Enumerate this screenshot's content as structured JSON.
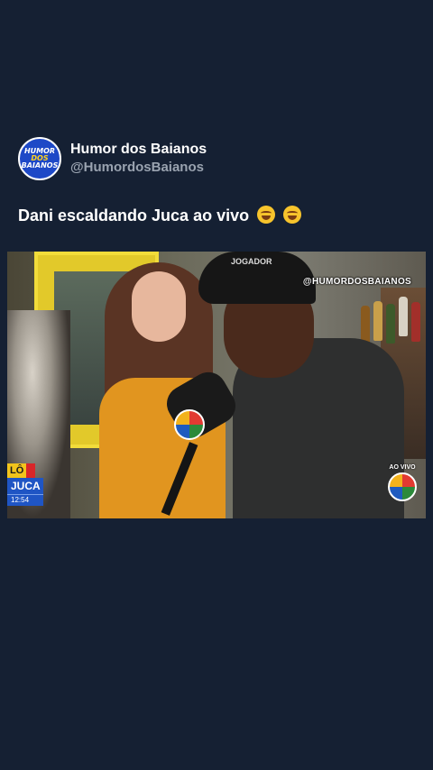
{
  "account": {
    "display_name": "Humor dos Baianos",
    "handle": "@HumordosBaianos",
    "avatar_lines": [
      "HUMOR",
      "DOS",
      "BAIANOS"
    ]
  },
  "post": {
    "caption": "Dani escaldando Juca ao vivo",
    "emoji_icons": [
      "laughing-tears-icon",
      "laughing-tears-icon"
    ]
  },
  "video": {
    "watermark": "@HUMORDOSBAIANOS",
    "cap_text": "JOGADOR",
    "live_label": "AO VIVO",
    "tag_prefix": "LÔ",
    "show_name": "JUCA",
    "clock": "12:54"
  },
  "colors": {
    "background": "#152033",
    "handle": "#9aa3b0",
    "avatar_bg": "#1e49c7",
    "tag_blue": "#1f55c4",
    "tag_yellow": "#f2c41c"
  }
}
